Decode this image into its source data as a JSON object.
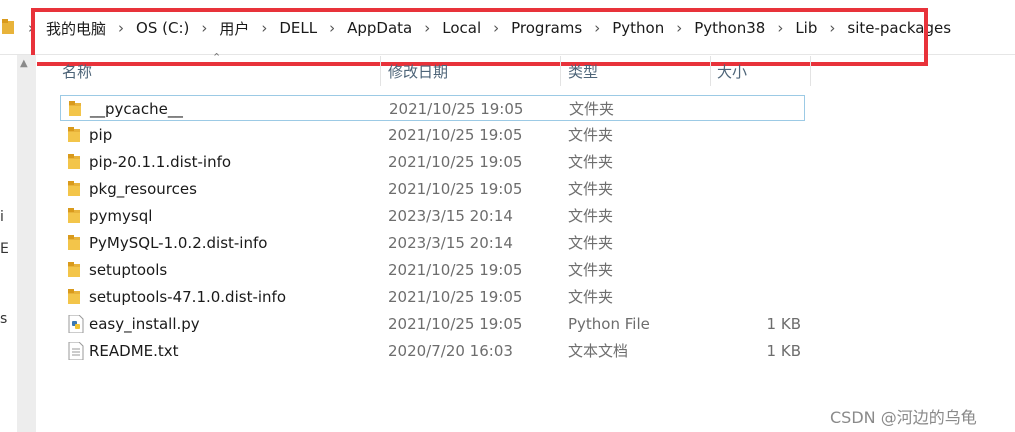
{
  "breadcrumb": {
    "items": [
      "我的电脑",
      "OS (C:)",
      "用户",
      "DELL",
      "AppData",
      "Local",
      "Programs",
      "Python",
      "Python38",
      "Lib",
      "site-packages"
    ],
    "highlight_color": "#e8323a"
  },
  "navpane": {
    "fragments": [
      "i",
      "E",
      "s"
    ]
  },
  "columns": {
    "name": "名称",
    "modified": "修改日期",
    "type": "类型",
    "size": "大小"
  },
  "files": [
    {
      "name": "__pycache__",
      "modified": "2021/10/25 19:05",
      "type": "文件夹",
      "size": "",
      "icon": "folder-icon"
    },
    {
      "name": "pip",
      "modified": "2021/10/25 19:05",
      "type": "文件夹",
      "size": "",
      "icon": "folder-icon"
    },
    {
      "name": "pip-20.1.1.dist-info",
      "modified": "2021/10/25 19:05",
      "type": "文件夹",
      "size": "",
      "icon": "folder-icon"
    },
    {
      "name": "pkg_resources",
      "modified": "2021/10/25 19:05",
      "type": "文件夹",
      "size": "",
      "icon": "folder-icon"
    },
    {
      "name": "pymysql",
      "modified": "2023/3/15 20:14",
      "type": "文件夹",
      "size": "",
      "icon": "folder-icon"
    },
    {
      "name": "PyMySQL-1.0.2.dist-info",
      "modified": "2023/3/15 20:14",
      "type": "文件夹",
      "size": "",
      "icon": "folder-icon"
    },
    {
      "name": "setuptools",
      "modified": "2021/10/25 19:05",
      "type": "文件夹",
      "size": "",
      "icon": "folder-icon"
    },
    {
      "name": "setuptools-47.1.0.dist-info",
      "modified": "2021/10/25 19:05",
      "type": "文件夹",
      "size": "",
      "icon": "folder-icon"
    },
    {
      "name": "easy_install.py",
      "modified": "2021/10/25 19:05",
      "type": "Python File",
      "size": "1 KB",
      "icon": "python-file-icon"
    },
    {
      "name": "README.txt",
      "modified": "2020/7/20 16:03",
      "type": "文本文档",
      "size": "1 KB",
      "icon": "text-file-icon"
    }
  ],
  "watermark": "CSDN @河边的乌龟"
}
